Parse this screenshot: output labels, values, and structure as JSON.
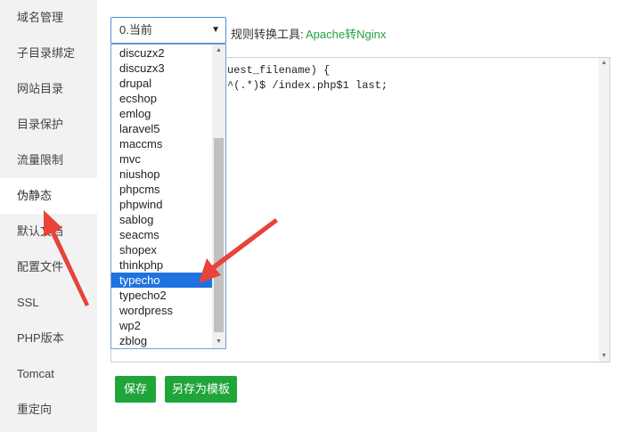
{
  "sidebar": {
    "items": [
      {
        "label": "域名管理"
      },
      {
        "label": "子目录绑定"
      },
      {
        "label": "网站目录"
      },
      {
        "label": "目录保护"
      },
      {
        "label": "流量限制"
      },
      {
        "label": "伪静态",
        "active": true
      },
      {
        "label": "默认文档"
      },
      {
        "label": "配置文件"
      },
      {
        "label": "SSL"
      },
      {
        "label": "PHP版本"
      },
      {
        "label": "Tomcat"
      },
      {
        "label": "重定向"
      }
    ]
  },
  "rewrite": {
    "select_value": "0.当前",
    "tool_label": "规则转换工具:",
    "tool_link": "Apache转Nginx"
  },
  "editor": {
    "line1": "uest_filename) {",
    "line2": "^(.*)$ /index.php$1 last;"
  },
  "dropdown": {
    "options": [
      "discuzx2",
      "discuzx3",
      "drupal",
      "ecshop",
      "emlog",
      "laravel5",
      "maccms",
      "mvc",
      "niushop",
      "phpcms",
      "phpwind",
      "sablog",
      "seacms",
      "shopex",
      "thinkphp",
      "typecho",
      "typecho2",
      "wordpress",
      "wp2",
      "zblog"
    ],
    "selected": "typecho"
  },
  "buttons": {
    "save": "保存",
    "save_template": "另存为模板"
  },
  "colors": {
    "accent": "#20a53a",
    "selection": "#1e73e0",
    "arrow": "#e8423a"
  },
  "icons": {
    "dropdown": "chevron-down-icon"
  }
}
